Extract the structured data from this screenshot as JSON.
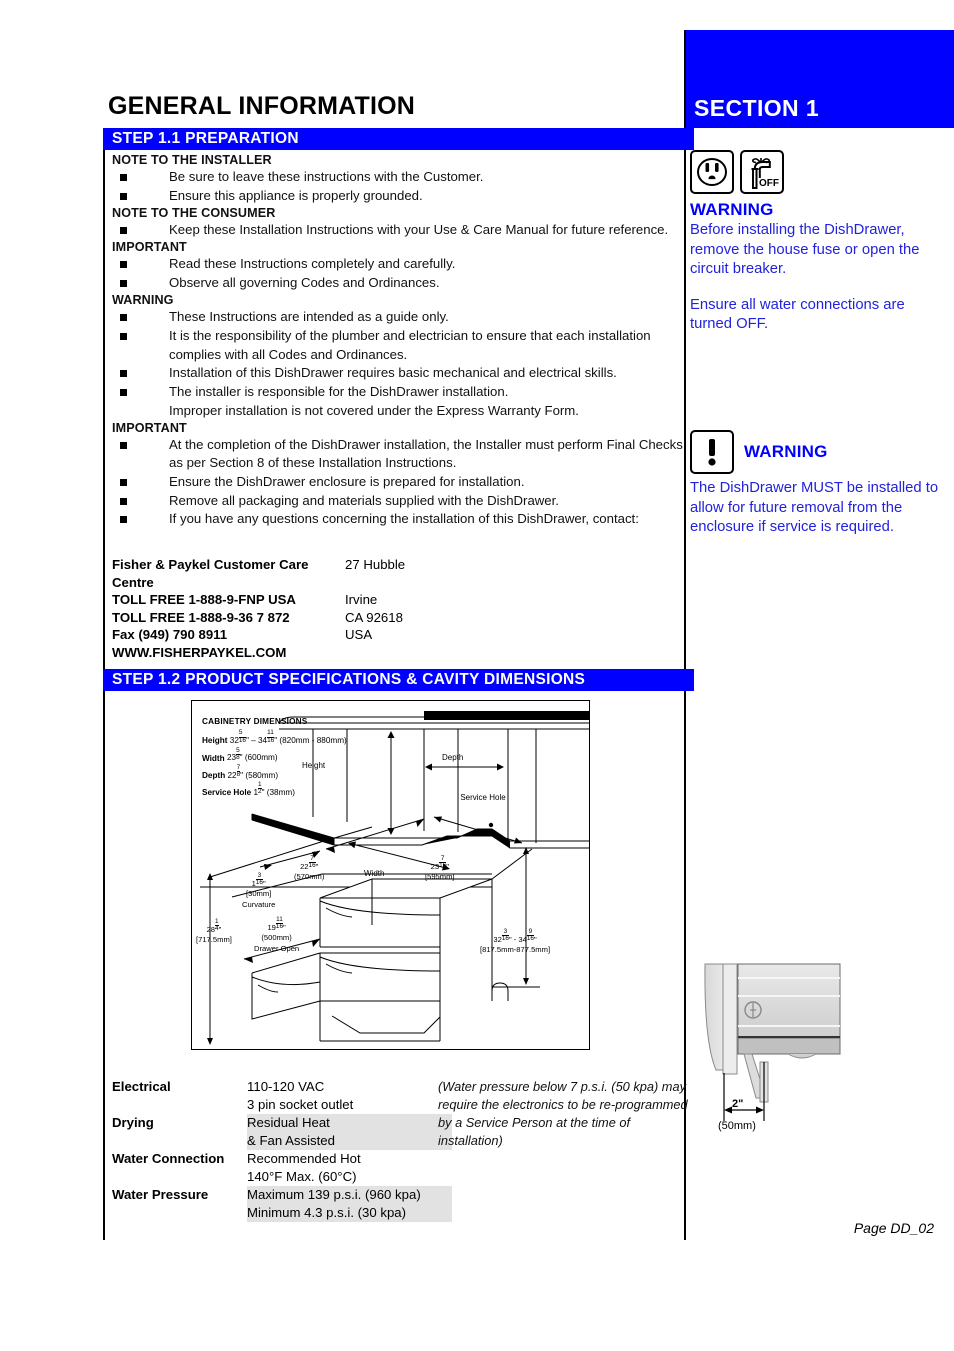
{
  "page": {
    "title": "GENERAL  INFORMATION",
    "section_label": "SECTION  1",
    "footer": "Page DD_02",
    "accent_blue": "#0000FF"
  },
  "steps": {
    "step_1_1": "STEP  1.1   PREPARATION",
    "step_1_2": "STEP  1.2  PRODUCT SPECIFICATIONS & CAVITY DIMENSIONS"
  },
  "body": {
    "blocks": [
      {
        "heading": "NOTE TO THE INSTALLER",
        "items": [
          "Be sure to leave these instructions with the Customer.",
          "Ensure this appliance is properly grounded."
        ]
      },
      {
        "heading": "NOTE TO THE CONSUMER",
        "items": [
          "Keep these Installation Instructions with your Use & Care Manual for future reference."
        ]
      },
      {
        "heading": "IMPORTANT",
        "items": [
          "Read these Instructions completely and carefully.",
          "Observe all governing Codes and Ordinances."
        ]
      },
      {
        "heading": "WARNING",
        "items": [
          "These Instructions are intended as a guide only.",
          "It is the responsibility of the plumber and electrician to ensure that each installation complies with all Codes and Ordinances.",
          "Installation of this DishDrawer requires basic mechanical and electrical skills.",
          "The installer is responsible for the DishDrawer installation."
        ],
        "continuation": "Improper installation is not covered under the Express Warranty Form."
      },
      {
        "heading": "IMPORTANT",
        "items": [
          "At the completion of the DishDrawer installation, the Installer must perform Final Checks as per Section 8 of these Installation Instructions.",
          "Ensure the DishDrawer enclosure is prepared for installation.",
          "Remove all packaging and materials supplied with the DishDrawer.",
          "If you have any questions concerning the installation of this DishDrawer, contact:"
        ]
      }
    ]
  },
  "contact": {
    "rows": [
      {
        "left": "Fisher & Paykel Customer Care Centre",
        "right": "27 Hubble"
      },
      {
        "left": "TOLL FREE 1-888-9-FNP USA",
        "right": "Irvine"
      },
      {
        "left": "TOLL FREE 1-888-9-36 7 872",
        "right": "CA 92618"
      },
      {
        "left": "Fax (949) 790 8911",
        "right": "USA"
      },
      {
        "left": "WWW.FISHERPAYKEL.COM",
        "right": ""
      }
    ]
  },
  "sidebar": {
    "warning_1": {
      "icons": [
        "power-outlet-icon",
        "water-tap-off-icon"
      ],
      "tap_off_label": "OFF",
      "title": "WARNING",
      "paragraph_1": "Before installing the DishDrawer, remove the house fuse or open the circuit breaker.",
      "paragraph_2": "Ensure all water connections are turned OFF."
    },
    "warning_2": {
      "icon": "exclamation-icon",
      "title": "WARNING",
      "paragraph": "The DishDrawer MUST be installed to allow for future removal from the enclosure if service is required."
    }
  },
  "diagram": {
    "cabinetry_title": "CABINETRY DIMENSIONS",
    "rows": [
      {
        "label": "Height",
        "whole1": "32",
        "num1": "5",
        "den1": "16",
        "whole2": "34",
        "num2": "11",
        "den2": "16",
        "metric": "(820mm - 880mm)"
      },
      {
        "label": "Width",
        "whole1": "23",
        "num1": "5",
        "den1": "8",
        "metric": "(600mm)"
      },
      {
        "label": "Depth",
        "whole1": "22",
        "num1": "7",
        "den1": "8",
        "metric": "(580mm)"
      },
      {
        "label": "Service Hole",
        "whole1": "1",
        "num1": "1",
        "den1": "2",
        "metric": "(38mm)"
      }
    ],
    "callouts": {
      "height": "Height",
      "depth": "Depth",
      "width": "Width",
      "service_hole": "Service Hole"
    },
    "measurements": {
      "top_front_depth": {
        "imperial": "22",
        "num": "7",
        "den": "16",
        "metric": "(570mm)"
      },
      "top_side_width": {
        "imperial": "23",
        "num": "7",
        "den": "16",
        "metric": "[595mm]"
      },
      "curvature": {
        "imperial": "1",
        "num": "3",
        "den": "16",
        "metric": "[30mm]",
        "note": "Curvature"
      },
      "drawer_open": {
        "imperial": "19",
        "num": "11",
        "den": "16",
        "metric": "(500mm)",
        "note": "Drawer Open"
      },
      "overall_height": {
        "imperial": "28",
        "num": "1",
        "den": "4",
        "metric": "[717.5mm]"
      },
      "cavity_height": {
        "imperial1": "32",
        "num1": "3",
        "den1": "16",
        "imperial2": "34",
        "num2": "9",
        "den2": "16",
        "metric": "[817.5mm-877.5mm]"
      }
    }
  },
  "specs": {
    "rows": [
      {
        "key": "Electrical",
        "values": [
          "110-120 VAC",
          "3 pin socket outlet"
        ],
        "shaded": false
      },
      {
        "key": "Drying",
        "values": [
          "Residual Heat",
          "& Fan Assisted"
        ],
        "shaded": true
      },
      {
        "key": "Water Connection",
        "values": [
          "Recommended Hot",
          "140°F Max. (60°C)"
        ],
        "shaded": false
      },
      {
        "key": "Water Pressure",
        "values": [
          "Maximum 139 p.s.i. (960 kpa)",
          "Minimum 4.3 p.s.i. (30 kpa)"
        ],
        "shaded": true
      }
    ],
    "note": "(Water pressure below 7 p.s.i. (50 kpa) may require the electronics to be re-programmed by a Service Person at the time of installation)"
  },
  "appliance_photo": {
    "dim_label": "2\"",
    "dim_metric": "(50mm)"
  }
}
